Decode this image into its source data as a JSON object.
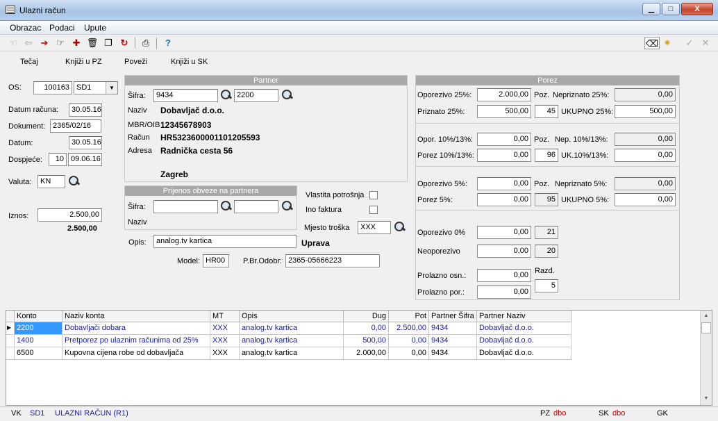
{
  "window": {
    "title": "Ulazni račun",
    "minimize": "▁",
    "maximize": "□",
    "close": "X"
  },
  "menu": [
    "Obrazac",
    "Podaci",
    "Upute"
  ],
  "toolbar": {
    "help": "?"
  },
  "actions": [
    "Tečaj",
    "Knjiži u PZ",
    "Poveži",
    "Knjiži u SK"
  ],
  "left": {
    "os_label": "OS:",
    "os_value": "100163",
    "os_combo": "SD1",
    "datum_racuna_label": "Datum računa:",
    "datum_racuna": "30.05.16",
    "dokument_label": "Dokument:",
    "dokument": "2365/02/16",
    "datum_label": "Datum:",
    "datum": "30.05.16",
    "dospijece_label": "Dospjeće:",
    "dospijece_dani": "10",
    "dospijece": "09.06.16",
    "valuta_label": "Valuta:",
    "valuta": "KN",
    "iznos_label": "Iznos:",
    "iznos": "2.500,00",
    "iznos_total": "2.500,00"
  },
  "partner": {
    "header": "Partner",
    "sifra_label": "Šifra:",
    "sifra": "9434",
    "sifra2": "2200",
    "naziv_label": "Naziv",
    "naziv": "Dobavljač d.o.o.",
    "mbr_label": "MBR/OIB",
    "mbr": "12345678903",
    "racun_label": "Račun",
    "racun": "HR5323600001101205593",
    "adresa_label": "Adresa",
    "adresa": "Radnička cesta 56",
    "grad": "Zagreb"
  },
  "prijenos": {
    "header": "Prijenos obveze na partnera",
    "sifra_label": "Šifra:",
    "sifra": "",
    "sifra2": "",
    "naziv_label": "Naziv"
  },
  "flags": {
    "vlastita_label": "Vlastita potrošnja",
    "ino_label": "Ino faktura",
    "mjesto_label": "Mjesto troška",
    "mjesto": "XXX",
    "mjesto_naziv": "Uprava"
  },
  "opis": {
    "label": "Opis:",
    "value": "analog.tv kartica"
  },
  "model": {
    "label": "Model:",
    "value": "HR00",
    "pbr_label": "P.Br.Odobr:",
    "pbr": "2365-05666223"
  },
  "porez": {
    "header": "Porez",
    "oporezivo25_label": "Oporezivo 25%:",
    "oporezivo25": "2.000,00",
    "poz_label": "Poz.",
    "nepriznato25_label": "Nepriznato 25%:",
    "nepriznato25": "0,00",
    "priznato25_label": "Priznato 25%:",
    "priznato25": "500,00",
    "poz25": "45",
    "ukupno25_label": "UKUPNO 25%:",
    "ukupno25": "500,00",
    "opor10_label": "Opor. 10%/13%:",
    "opor10": "0,00",
    "nep10_label": "Nep. 10%/13%:",
    "nep10": "0,00",
    "porez10_label": "Porez 10%/13%:",
    "porez10": "0,00",
    "poz10": "96",
    "uk10_label": "UK.10%/13%:",
    "uk10": "0,00",
    "oporezivo5_label": "Oporezivo 5%:",
    "oporezivo5": "0,00",
    "nepriznato5_label": "Nepriznato 5%:",
    "nepriznato5": "0,00",
    "porez5_label": "Porez 5%:",
    "porez5": "0,00",
    "poz5": "95",
    "ukupno5_label": "UKUPNO 5%:",
    "ukupno5": "0,00",
    "oporezivo0_label": "Oporezivo 0%",
    "oporezivo0": "0,00",
    "poz0": "21",
    "neoporezivo_label": "Neoporezivo",
    "neoporezivo": "0,00",
    "pozneo": "20",
    "prolazno_osn_label": "Prolazno osn.:",
    "prolazno_osn": "0,00",
    "razd_label": "Razd.",
    "razd": "5",
    "prolazno_por_label": "Prolazno por.:",
    "prolazno_por": "0,00"
  },
  "grid": {
    "headers": [
      "Konto",
      "Naziv konta",
      "MT",
      "Opis",
      "Dug",
      "Pot",
      "Partner Šifra",
      "Partner Naziv"
    ],
    "rows": [
      [
        "2200",
        "Dobavljači dobara",
        "XXX",
        "analog.tv kartica",
        "0,00",
        "2.500,00",
        "9434",
        "Dobavljač d.o.o."
      ],
      [
        "1400",
        "Pretporez po ulaznim računima od 25%",
        "XXX",
        "analog.tv kartica",
        "500,00",
        "0,00",
        "9434",
        "Dobavljač d.o.o."
      ],
      [
        "6500",
        "Kupovna cijena robe od dobavljača",
        "XXX",
        "analog.tv kartica",
        "2.000,00",
        "0,00",
        "9434",
        "Dobavljač d.o.o."
      ]
    ]
  },
  "status": {
    "vk": "VK",
    "sd": "SD1",
    "doc": "ULAZNI RAČUN (R1)",
    "pz": "PZ",
    "pz_user": "dbo",
    "sk": "SK",
    "sk_user": "dbo",
    "gk": "GK"
  }
}
